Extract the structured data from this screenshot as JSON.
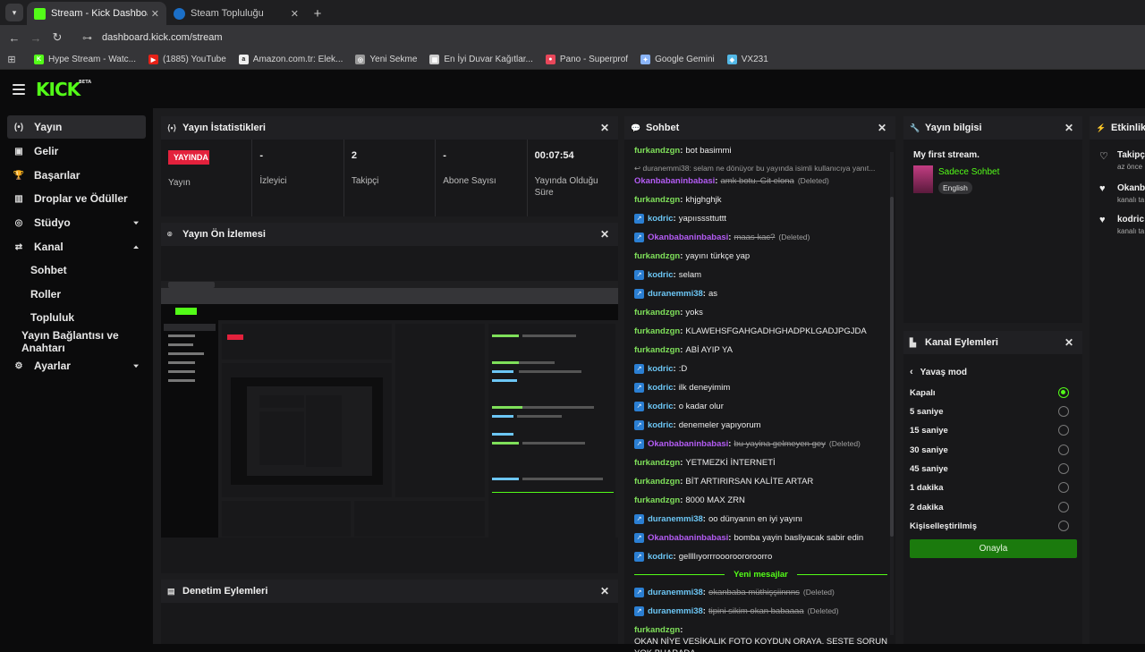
{
  "browser": {
    "tabs": [
      {
        "title": "Stream - Kick Dashboard",
        "active": true,
        "favicon_color": "#53fc18"
      },
      {
        "title": "Steam Topluluğu",
        "active": false,
        "favicon_color": "#1b6fc7"
      }
    ],
    "url": "dashboard.kick.com/stream",
    "bookmarks": [
      {
        "label": "Hype Stream - Watc...",
        "color": "#53fc18",
        "glyph": "K"
      },
      {
        "label": "(1885) YouTube",
        "color": "#e62117",
        "glyph": "▶"
      },
      {
        "label": "Amazon.com.tr: Elek...",
        "color": "#eeeeee",
        "glyph": "a"
      },
      {
        "label": "Yeni Sekme",
        "color": "#999999",
        "glyph": "◎"
      },
      {
        "label": "En İyi Duvar Kağıtlar...",
        "color": "#cccccc",
        "glyph": "▦"
      },
      {
        "label": "Pano - Superprof",
        "color": "#e8475a",
        "glyph": "●"
      },
      {
        "label": "Google Gemini",
        "color": "#8ab4f8",
        "glyph": "✦"
      },
      {
        "label": "VX231",
        "color": "#53b8e6",
        "glyph": "◈"
      }
    ]
  },
  "app": {
    "logo": "KICK",
    "logo_tag": "BETA",
    "accent": "#53fc18"
  },
  "sidebar": {
    "items": [
      {
        "label": "Yayın",
        "icon": "broadcast-icon",
        "glyph": "(•)",
        "active": true
      },
      {
        "label": "Gelir",
        "icon": "revenue-icon",
        "glyph": "▣"
      },
      {
        "label": "Başarılar",
        "icon": "trophy-icon",
        "glyph": "🏆"
      },
      {
        "label": "Droplar ve Ödüller",
        "icon": "drops-icon",
        "glyph": "▥"
      },
      {
        "label": "Stüdyo",
        "icon": "studio-icon",
        "glyph": "◎",
        "chevron": "down"
      },
      {
        "label": "Kanal",
        "icon": "channel-icon",
        "glyph": "⇄",
        "chevron": "up"
      },
      {
        "label": "Sohbet",
        "sub": true
      },
      {
        "label": "Roller",
        "sub": true
      },
      {
        "label": "Topluluk",
        "sub": true
      },
      {
        "label": "Yayın Bağlantısı ve Anahtarı",
        "sub": true
      },
      {
        "label": "Ayarlar",
        "icon": "settings-icon",
        "glyph": "⚙",
        "chevron": "down"
      }
    ]
  },
  "stats_panel": {
    "title": "Yayın İstatistikleri",
    "live_badge": "YAYINDA",
    "stats": [
      {
        "value": "",
        "caption": "Yayın"
      },
      {
        "value": "-",
        "caption": "İzleyici"
      },
      {
        "value": "2",
        "caption": "Takipçi"
      },
      {
        "value": "-",
        "caption": "Abone Sayısı"
      },
      {
        "value": "00:07:54",
        "caption": "Yayında Olduğu Süre"
      }
    ]
  },
  "preview_panel": {
    "title": "Yayın Ön İzlemesi"
  },
  "moderation_panel": {
    "title": "Denetim Eylemleri"
  },
  "chat": {
    "title": "Sohbet",
    "messages": [
      {
        "user": "furkandzgn",
        "color": "green",
        "text": "bot basimmi"
      },
      {
        "reply": "duranemmi38: selam ne dönüyor bu yayında isimli kullanıcıya yanıt...",
        "user": "Okanbabaninbabasi",
        "color": "purple",
        "text": "amk botu. Git elona",
        "deleted": true
      },
      {
        "user": "furkandzgn",
        "color": "green",
        "text": "khjghghjk"
      },
      {
        "user": "kodric",
        "color": "blue",
        "badge": true,
        "text": "yapıısssttuttt"
      },
      {
        "user": "Okanbabaninbabasi",
        "color": "purple",
        "badge": true,
        "text": "maas kac?",
        "deleted": true
      },
      {
        "user": "furkandzgn",
        "color": "green",
        "text": "yayını türkçe yap"
      },
      {
        "user": "kodric",
        "color": "blue",
        "badge": true,
        "text": "selam"
      },
      {
        "user": "duranemmi38",
        "color": "blue",
        "badge": true,
        "text": "as"
      },
      {
        "user": "furkandzgn",
        "color": "green",
        "text": "yoks"
      },
      {
        "user": "furkandzgn",
        "color": "green",
        "text": "KLAWEHSFGAHGADHGHADPKLGADJPGJDA"
      },
      {
        "user": "furkandzgn",
        "color": "green",
        "text": "ABİ AYIP YA"
      },
      {
        "user": "kodric",
        "color": "blue",
        "badge": true,
        "text": ":D"
      },
      {
        "user": "kodric",
        "color": "blue",
        "badge": true,
        "text": "ilk deneyimim"
      },
      {
        "user": "kodric",
        "color": "blue",
        "badge": true,
        "text": "o kadar olur"
      },
      {
        "user": "kodric",
        "color": "blue",
        "badge": true,
        "text": "denemeler yapıyorum"
      },
      {
        "user": "Okanbabaninbabasi",
        "color": "purple",
        "badge": true,
        "text": "bu yayina gelmeyen gey",
        "deleted": true
      },
      {
        "user": "furkandzgn",
        "color": "green",
        "text": "YETMEZKİ İNTERNETİ"
      },
      {
        "user": "furkandzgn",
        "color": "green",
        "text": "BİT ARTIRIRSAN KALİTE ARTAR"
      },
      {
        "user": "furkandzgn",
        "color": "green",
        "text": "8000 MAX ZRN"
      },
      {
        "user": "duranemmi38",
        "color": "blue",
        "badge": true,
        "text": "oo dünyanın en iyi yayını"
      },
      {
        "user": "Okanbabaninbabasi",
        "color": "purple",
        "badge": true,
        "text": "bomba yayin basliyacak sabir edin"
      },
      {
        "user": "kodric",
        "color": "blue",
        "badge": true,
        "text": "gellllıyorrroooroororoorro"
      }
    ],
    "new_messages_label": "Yeni mesajlar",
    "new_messages": [
      {
        "user": "duranemmi38",
        "color": "blue",
        "badge": true,
        "text": "okanbaba müthişşiinnns",
        "deleted": true
      },
      {
        "user": "duranemmi38",
        "color": "blue",
        "badge": true,
        "text": "tipini sikim okan babaaaa",
        "deleted": true
      },
      {
        "user": "furkandzgn",
        "color": "green",
        "text": "OKAN NİYE VESİKALIK FOTO KOYDUN ORAYA. SESTE SORUN YOK BUARADA"
      }
    ],
    "deleted_label": "(Deleted)"
  },
  "stream_info": {
    "title": "Yayın bilgisi",
    "stream_title": "My first stream.",
    "category": "Sadece Sohbet",
    "language": "English"
  },
  "channel_actions": {
    "title": "Kanal Eylemleri",
    "section": "Yavaş mod",
    "options": [
      {
        "label": "Kapalı",
        "selected": true
      },
      {
        "label": "5 saniye",
        "selected": false
      },
      {
        "label": "15 saniye",
        "selected": false
      },
      {
        "label": "30 saniye",
        "selected": false
      },
      {
        "label": "45 saniye",
        "selected": false
      },
      {
        "label": "1 dakika",
        "selected": false
      },
      {
        "label": "2 dakika",
        "selected": false
      },
      {
        "label": "Kişiselleştirilmiş",
        "selected": false
      }
    ],
    "confirm": "Onayla"
  },
  "activity": {
    "title": "Etkinlik A",
    "items": [
      {
        "name": "Takipç",
        "sub": "az önce"
      },
      {
        "name": "Okanb",
        "sub": "kanalı ta"
      },
      {
        "name": "kodric",
        "sub": "kanalı ta"
      }
    ]
  }
}
